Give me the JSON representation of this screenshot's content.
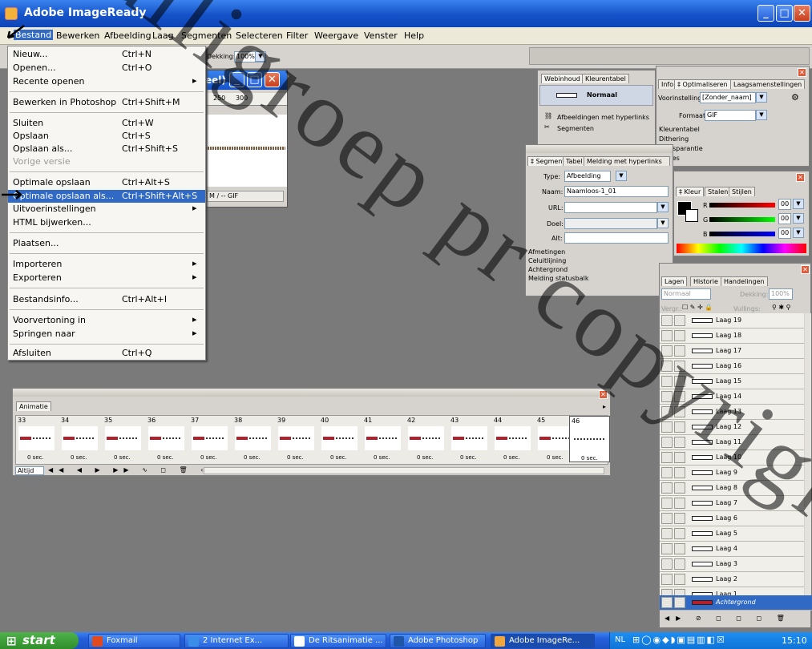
{
  "app": {
    "title": "Adobe ImageReady"
  },
  "menu": [
    "Bestand",
    "Bewerken",
    "Afbeelding",
    "Laag",
    "Segmenten",
    "Selecteren",
    "Filter",
    "Weergave",
    "Venster",
    "Help"
  ],
  "options": {
    "dekking_label": "Dekking:",
    "dekking_value": "100%"
  },
  "file_menu": [
    {
      "label": "Nieuw...",
      "shortcut": "Ctrl+N"
    },
    {
      "label": "Openen...",
      "shortcut": "Ctrl+O"
    },
    {
      "label": "Recente openen",
      "shortcut": "",
      "sub": "▸"
    },
    {
      "label": "Bewerken in Photoshop",
      "shortcut": "Ctrl+Shift+M"
    },
    {
      "label": "Sluiten",
      "shortcut": "Ctrl+W"
    },
    {
      "label": "Opslaan",
      "shortcut": "Ctrl+S"
    },
    {
      "label": "Opslaan als...",
      "shortcut": "Ctrl+Shift+S"
    },
    {
      "label": "Vorige versie",
      "shortcut": ""
    },
    {
      "label": "Optimale opslaan",
      "shortcut": "Ctrl+Alt+S"
    },
    {
      "label": "Optimale opslaan als...",
      "shortcut": "Ctrl+Shift+Alt+S"
    },
    {
      "label": "Uitvoerinstellingen",
      "shortcut": "",
      "sub": "▸"
    },
    {
      "label": "HTML bijwerken...",
      "shortcut": ""
    },
    {
      "label": "Plaatsen...",
      "shortcut": ""
    },
    {
      "label": "Importeren",
      "shortcut": "",
      "sub": "▸"
    },
    {
      "label": "Exporteren",
      "shortcut": "",
      "sub": "▸"
    },
    {
      "label": "Bestandsinfo...",
      "shortcut": "Ctrl+Alt+I"
    },
    {
      "label": "Voorvertoning in",
      "shortcut": "",
      "sub": "▸"
    },
    {
      "label": "Springen naar",
      "shortcut": "",
      "sub": "▸"
    },
    {
      "label": "Afsluiten",
      "shortcut": "Ctrl+Q"
    }
  ],
  "doc": {
    "title_suffix": "eel)",
    "ruler_250": "250",
    "ruler_300": "300",
    "status": "M / -- GIF"
  },
  "webcontent": {
    "tabs": [
      "Webinhoud",
      "Kleurentabel"
    ],
    "normal_label": "Normaal",
    "items": [
      "Afbeeldingen met hyperlinks",
      "Segmenten"
    ]
  },
  "optimize": {
    "tabs": [
      "Info",
      "‡ Optimaliseren",
      "Laagsamenstellingen"
    ],
    "voorinstelling_label": "Voorinstelling:",
    "voorinstelling_value": "[Zonder_naam]",
    "formaat_label": "Formaat:",
    "formaat_value": "GIF",
    "sections": [
      "Kleurentabel",
      "Dithering",
      "Transparantie",
      "Opties"
    ]
  },
  "segment": {
    "tabs": [
      "‡ Segment",
      "Tabel",
      "Melding met hyperlinks"
    ],
    "type_label": "Type:",
    "type_value": "Afbeelding",
    "naam_label": "Naam:",
    "naam_value": "Naamloos-1_01",
    "url_label": "URL:",
    "doel_label": "Doel:",
    "alt_label": "Alt:",
    "sections": [
      "Afmetingen",
      "Celuitlijning",
      "Achtergrond",
      "Melding statusbalk"
    ]
  },
  "color": {
    "tabs": [
      "‡ Kleur",
      "Stalen",
      "Stijlen"
    ],
    "channels": [
      {
        "name": "R",
        "value": "00"
      },
      {
        "name": "G",
        "value": "00"
      },
      {
        "name": "B",
        "value": "00"
      }
    ]
  },
  "layers": {
    "tabs": [
      "Lagen",
      "Historie",
      "Handelingen"
    ],
    "blend": "Normaal",
    "dekking_label": "Dekking:",
    "dekking": "100%",
    "vergr_label": "Vergr.:",
    "vulling_label": "Vullings:",
    "items": [
      "Laag 19",
      "Laag 18",
      "Laag 17",
      "Laag 16",
      "Laag 15",
      "Laag 14",
      "Laag 13",
      "Laag 12",
      "Laag 11",
      "Laag 10",
      "Laag 9",
      "Laag 8",
      "Laag 7",
      "Laag 6",
      "Laag 5",
      "Laag 4",
      "Laag 3",
      "Laag 2",
      "Laag 1",
      "Achtergrond"
    ]
  },
  "animation": {
    "tab": "Animatie",
    "frames": [
      "33",
      "34",
      "35",
      "36",
      "37",
      "38",
      "39",
      "40",
      "41",
      "42",
      "43",
      "44",
      "45",
      "46"
    ],
    "delay": "0 sec.",
    "loop": "Altijd"
  },
  "taskbar": {
    "start": "start",
    "tasks": [
      {
        "label": "Foxmail",
        "color": "#e04a1e"
      },
      {
        "label": "2 Internet Ex...",
        "color": "#3a8de8"
      },
      {
        "label": "De Ritsanimatie ...",
        "color": "#2f6ec9"
      },
      {
        "label": "Adobe Photoshop",
        "color": "#1f56a8"
      },
      {
        "label": "Adobe ImageRe...",
        "color": "#f0a640"
      }
    ],
    "lang": "NL",
    "time": "15:10"
  },
  "watermark": "Huiligroep pr copyright"
}
